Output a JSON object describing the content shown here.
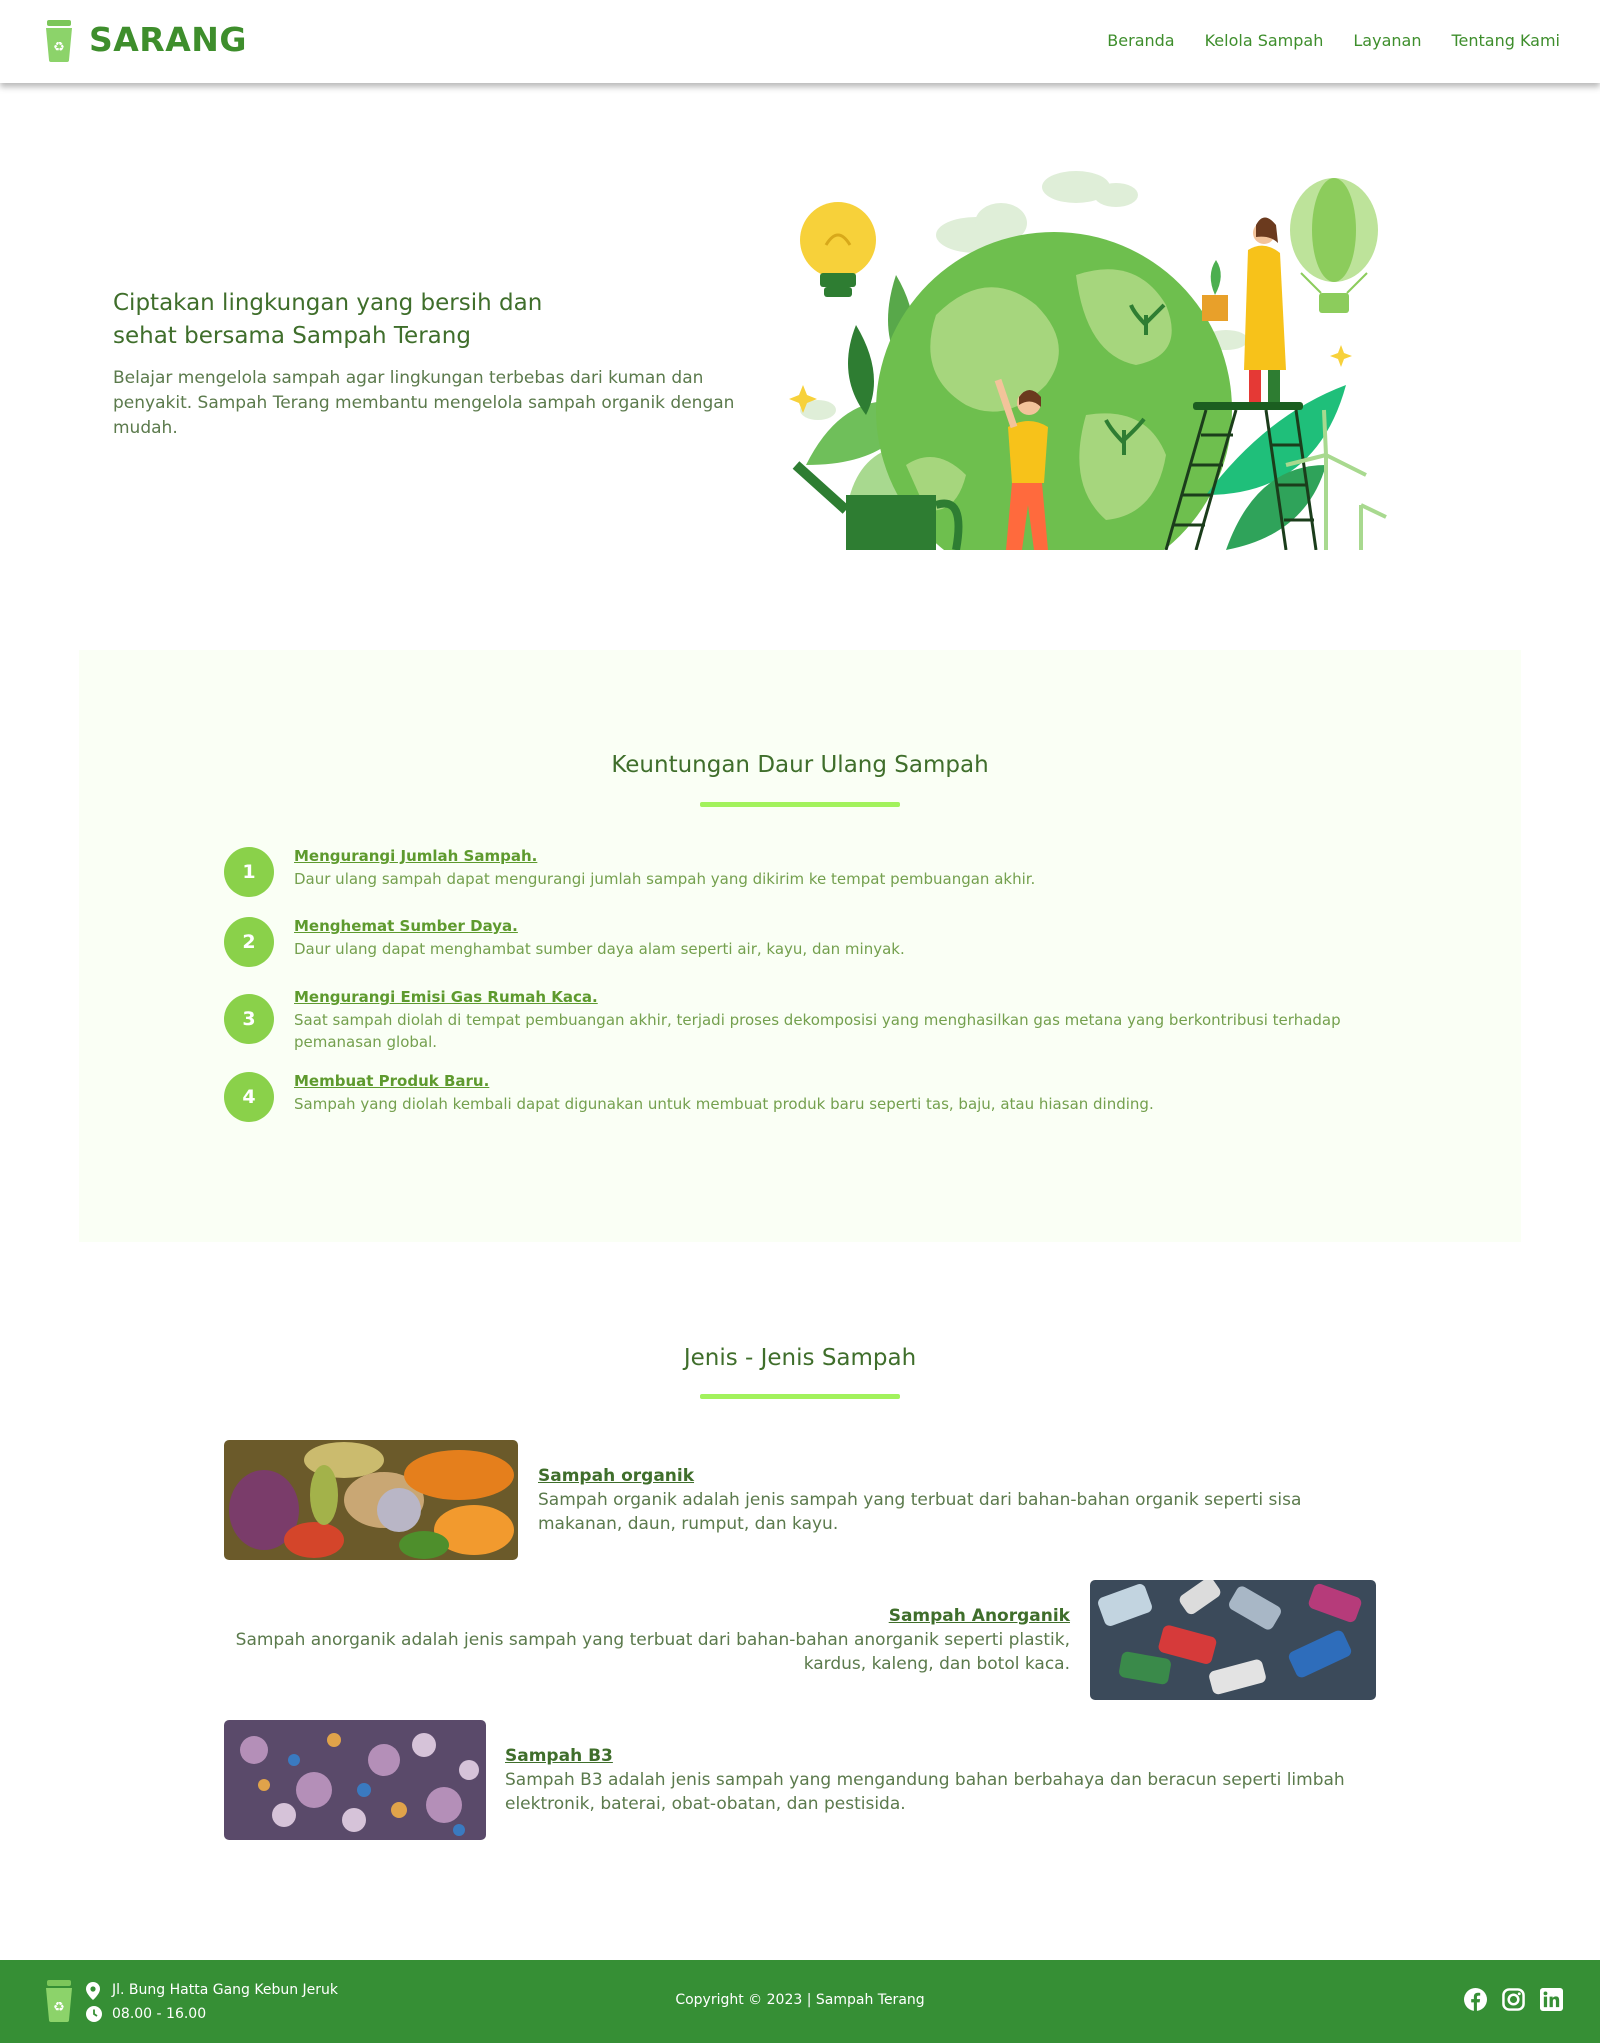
{
  "header": {
    "brand": "SARANG",
    "nav": [
      "Beranda",
      "Kelola Sampah",
      "Layanan",
      "Tentang Kami"
    ]
  },
  "hero": {
    "title": "Ciptakan lingkungan yang bersih dan sehat bersama Sampah Terang",
    "text": "Belajar mengelola sampah agar lingkungan terbebas dari kuman dan penyakit. Sampah Terang membantu mengelola sampah organik dengan mudah."
  },
  "benefits": {
    "title": "Keuntungan Daur Ulang Sampah",
    "items": [
      {
        "num": "1",
        "title": "Mengurangi Jumlah Sampah.",
        "desc": "Daur ulang sampah dapat mengurangi jumlah sampah yang dikirim ke tempat pembuangan akhir."
      },
      {
        "num": "2",
        "title": "Menghemat Sumber Daya.",
        "desc": "Daur ulang dapat menghambat sumber daya alam seperti air, kayu, dan minyak."
      },
      {
        "num": "3",
        "title": "Mengurangi Emisi Gas Rumah Kaca.",
        "desc": "Saat sampah diolah di tempat pembuangan akhir, terjadi proses dekomposisi yang menghasilkan gas metana yang berkontribusi terhadap pemanasan global."
      },
      {
        "num": "4",
        "title": "Membuat Produk Baru.",
        "desc": "Sampah yang diolah kembali dapat digunakan untuk membuat produk baru seperti tas, baju, atau hiasan dinding."
      }
    ]
  },
  "types": {
    "title": "Jenis - Jenis Sampah",
    "items": [
      {
        "title": "Sampah organik",
        "desc": "Sampah organik adalah jenis sampah yang terbuat dari bahan-bahan organik seperti sisa makanan, daun, rumput, dan kayu."
      },
      {
        "title": "Sampah Anorganik",
        "desc": "Sampah anorganik adalah jenis sampah yang terbuat dari bahan-bahan anorganik seperti plastik, kardus, kaleng, dan botol kaca."
      },
      {
        "title": "Sampah B3",
        "desc": "Sampah B3 adalah jenis sampah yang mengandung bahan berbahaya dan beracun seperti limbah elektronik, baterai, obat-obatan, dan pestisida."
      }
    ]
  },
  "footer": {
    "address": "Jl. Bung Hatta Gang Kebun Jeruk",
    "hours": "08.00 - 16.00",
    "copyright": "Copyright © 2023 | Sampah Terang"
  },
  "colors": {
    "primary": "#368f35",
    "accent": "#a2f25c",
    "badge": "#8ad14a"
  }
}
